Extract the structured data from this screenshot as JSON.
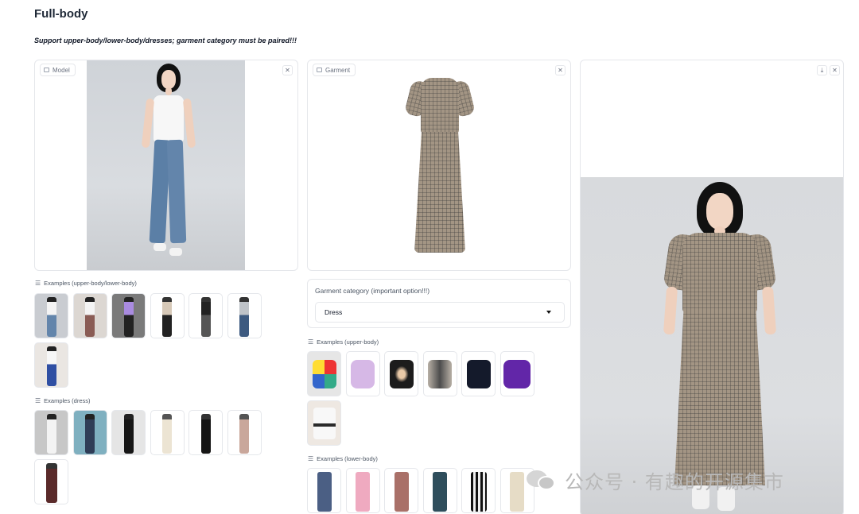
{
  "page": {
    "title": "Full-body",
    "subtitle": "Support upper-body/lower-body/dresses; garment category must be paired!!!"
  },
  "model_panel": {
    "label": "Model",
    "clear_icon": "close-icon"
  },
  "garment_panel": {
    "label": "Garment",
    "clear_icon": "close-icon"
  },
  "result_panel": {
    "download_icon": "download-icon",
    "clear_icon": "close-icon"
  },
  "examples_model": {
    "label": "Examples (upper-body/lower-body)",
    "count": 7
  },
  "examples_dress": {
    "label": "Examples (dress)",
    "count": 7
  },
  "garment_category": {
    "label": "Garment category (important option!!!)",
    "value": "Dress"
  },
  "examples_upper": {
    "label": "Examples (upper-body)",
    "count": 7
  },
  "examples_lower": {
    "label": "Examples (lower-body)",
    "count": 6
  },
  "watermark": {
    "text": "公众号 · 有趣的开源集市"
  },
  "colors": {
    "border": "#e5e7eb",
    "label_text": "#6b7280",
    "dress_plaid": "#a39584"
  }
}
